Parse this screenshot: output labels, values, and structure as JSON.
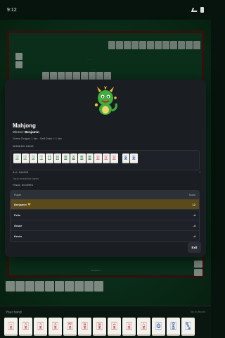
{
  "status_bar": {
    "time": "9:12"
  },
  "table": {
    "top_hint": "··· ···",
    "center_hint": "··· ···",
    "bottom_hint": "Benjamin ···"
  },
  "modal": {
    "title": "Mahjong",
    "winner_prefix": "Winner:",
    "winner_name": "Benjamin",
    "fan_breakdown": "Green Dragon 1 fan · Self Draw + 1 fan",
    "winning_hand_label": "WINNING HAND",
    "winning_hand_tiles": [
      "🀐",
      "🀐",
      "🀐",
      "🀑",
      "🀓",
      "🀔",
      "🀕",
      "🀖",
      "🀗",
      "🀘",
      "🀅",
      "🀅",
      "🀅",
      "🀙",
      "🀙"
    ],
    "all_hands_label": "ALL HANDS",
    "all_hands_hint": "Tap to reveal/hide hands",
    "final_scores_label": "FINAL SCORES",
    "scores_header": {
      "player": "Player",
      "score": "Score"
    },
    "scores": [
      {
        "player": "Benjamin 🏆",
        "score": "12"
      },
      {
        "player": "Felix",
        "score": "-4"
      },
      {
        "player": "Grace",
        "score": "-4"
      },
      {
        "player": "Kevin",
        "score": "-4"
      }
    ],
    "exit_label": "Exit"
  },
  "hand": {
    "label": "Your hand",
    "hint": "Tap to discard",
    "tiles": [
      "🀇",
      "🀈",
      "🀈",
      "🀉",
      "🀊",
      "🀋",
      "🀋",
      "🀌",
      "🀍",
      "🀎",
      "🀙",
      "🀚",
      "🀛"
    ]
  }
}
